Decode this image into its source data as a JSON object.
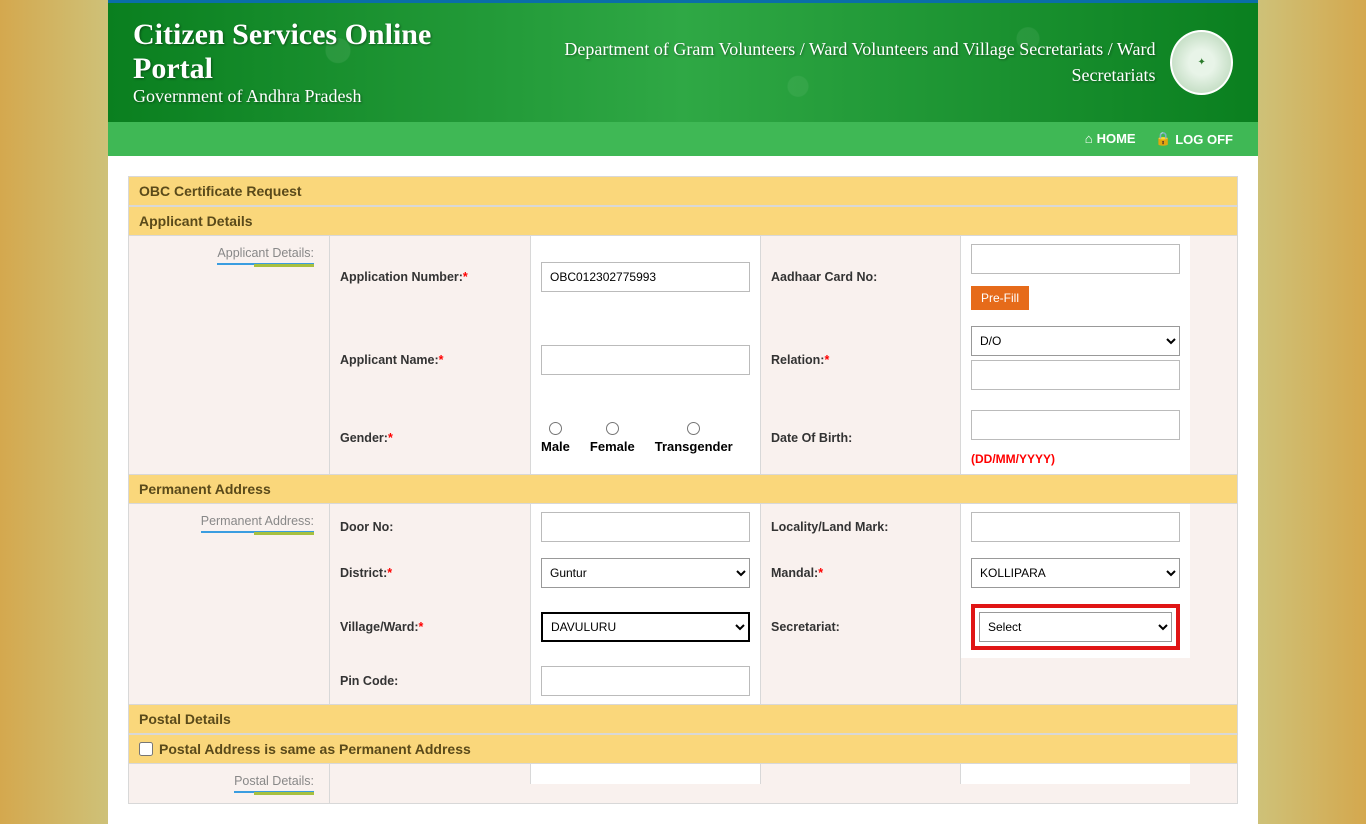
{
  "header": {
    "title": "Citizen Services Online Portal",
    "subtitle": "Government of Andhra Pradesh",
    "department": "Department of Gram Volunteers / Ward Volunteers and Village Secretariats / Ward Secretariats"
  },
  "nav": {
    "home": "HOME",
    "logoff": "LOG OFF"
  },
  "panel": {
    "title": "OBC Certificate Request"
  },
  "applicant": {
    "section_title": "Applicant Details",
    "side_label": "Applicant Details:",
    "app_num_label": "Application Number:",
    "app_num_value": "OBC012302775993",
    "aadhaar_label": "Aadhaar Card No:",
    "prefill_btn": "Pre-Fill",
    "name_label": "Applicant Name:",
    "relation_label": "Relation:",
    "relation_value": "D/O",
    "gender_label": "Gender:",
    "gender_male": "Male",
    "gender_female": "Female",
    "gender_trans": "Transgender",
    "dob_label": "Date Of Birth:",
    "dob_hint": "(DD/MM/YYYY)"
  },
  "permanent": {
    "section_title": "Permanent Address",
    "side_label": "Permanent Address:",
    "door_label": "Door No:",
    "locality_label": "Locality/Land Mark:",
    "district_label": "District:",
    "district_value": "Guntur",
    "mandal_label": "Mandal:",
    "mandal_value": "KOLLIPARA",
    "village_label": "Village/Ward:",
    "village_value": "DAVULURU",
    "secretariat_label": "Secretariat:",
    "secretariat_value": "Select",
    "pincode_label": "Pin Code:"
  },
  "postal": {
    "section_title": "Postal Details",
    "same_as_label": "Postal Address is same as Permanent Address",
    "side_label": "Postal Details:"
  }
}
